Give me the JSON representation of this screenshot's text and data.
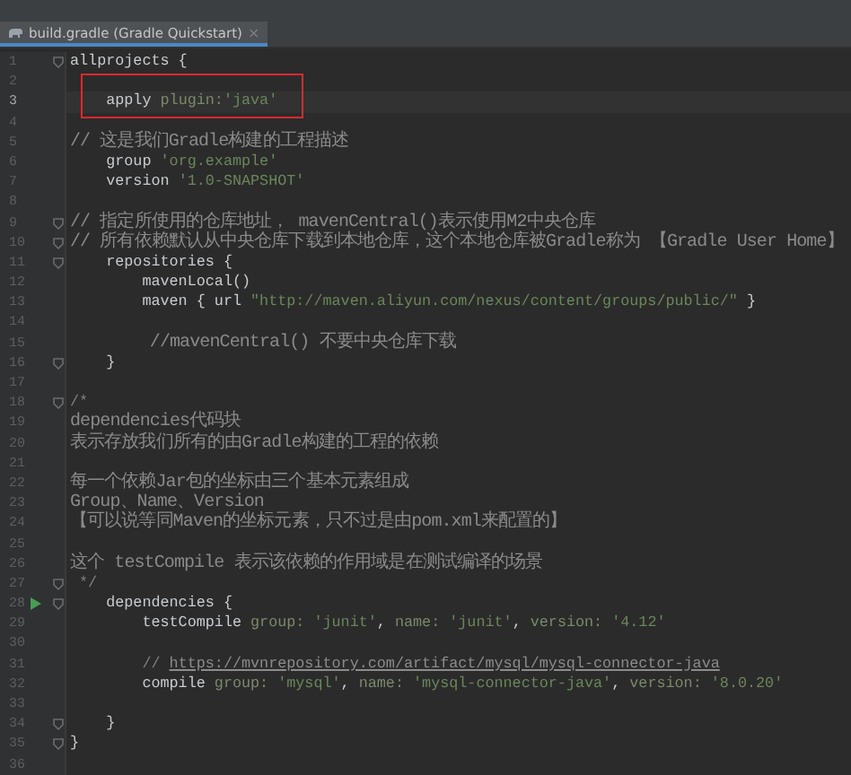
{
  "tab": {
    "title": "build.gradle (Gradle Quickstart)",
    "close": "×",
    "selected": true
  },
  "lines": [
    {
      "n": "1",
      "fold": true,
      "tokens": [
        {
          "kind": "plain",
          "text": "allprojects {"
        }
      ]
    },
    {
      "n": "2",
      "boxed": true
    },
    {
      "n": "3",
      "boxed": true,
      "current": true,
      "tokens": [
        {
          "kind": "plain",
          "text": "    apply "
        },
        {
          "kind": "arg",
          "text": "plugin:"
        },
        {
          "kind": "string",
          "text": "'java'"
        }
      ]
    },
    {
      "n": "4"
    },
    {
      "n": "5",
      "tokens": [
        {
          "kind": "note",
          "text": "// 这是我们Gradle构建的工程描述"
        }
      ]
    },
    {
      "n": "6",
      "tokens": [
        {
          "kind": "plain",
          "text": "    group "
        },
        {
          "kind": "string",
          "text": "'org.example'"
        }
      ]
    },
    {
      "n": "7",
      "tokens": [
        {
          "kind": "plain",
          "text": "    version "
        },
        {
          "kind": "string",
          "text": "'1.0-SNAPSHOT'"
        }
      ]
    },
    {
      "n": "8"
    },
    {
      "n": "9",
      "fold": true,
      "tokens": [
        {
          "kind": "note",
          "text": "// 指定所使用的仓库地址， mavenCentral()表示使用M2中央仓库"
        }
      ]
    },
    {
      "n": "10",
      "fold": true,
      "tokens": [
        {
          "kind": "note",
          "text": "// 所有依赖默认从中央仓库下载到本地仓库，这个本地仓库被Gradle称为 【Gradle User Home】"
        }
      ]
    },
    {
      "n": "11",
      "fold": true,
      "tokens": [
        {
          "kind": "plain",
          "text": "    repositories {"
        }
      ]
    },
    {
      "n": "12",
      "tokens": [
        {
          "kind": "plain",
          "text": "        mavenLocal()"
        }
      ]
    },
    {
      "n": "13",
      "tokens": [
        {
          "kind": "plain",
          "text": "        maven { url "
        },
        {
          "kind": "string",
          "text": "\"http://maven.aliyun.com/nexus/content/groups/public/\""
        },
        {
          "kind": "plain",
          "text": " }"
        }
      ]
    },
    {
      "n": "14"
    },
    {
      "n": "15",
      "tokens": [
        {
          "kind": "note",
          "text": "        //mavenCentral() 不要中央仓库下载"
        }
      ]
    },
    {
      "n": "16",
      "fold": true,
      "tokens": [
        {
          "kind": "plain",
          "text": "    }"
        }
      ]
    },
    {
      "n": "17"
    },
    {
      "n": "18",
      "fold": true,
      "tokens": [
        {
          "kind": "comment",
          "text": "/*"
        }
      ]
    },
    {
      "n": "19",
      "tokens": [
        {
          "kind": "note",
          "text": "dependencies代码块"
        }
      ]
    },
    {
      "n": "20",
      "tokens": [
        {
          "kind": "note",
          "text": "表示存放我们所有的由Gradle构建的工程的依赖"
        }
      ]
    },
    {
      "n": "21"
    },
    {
      "n": "22",
      "tokens": [
        {
          "kind": "note",
          "text": "每一个依赖Jar包的坐标由三个基本元素组成"
        }
      ]
    },
    {
      "n": "23",
      "tokens": [
        {
          "kind": "note",
          "text": "Group、Name、Version"
        }
      ]
    },
    {
      "n": "24",
      "tokens": [
        {
          "kind": "note",
          "text": "【可以说等同Maven的坐标元素，只不过是由pom.xml来配置的】"
        }
      ]
    },
    {
      "n": "25"
    },
    {
      "n": "26",
      "tokens": [
        {
          "kind": "note",
          "text": "这个 testCompile 表示该依赖的作用域是在测试编译的场景"
        }
      ]
    },
    {
      "n": "27",
      "fold": true,
      "tokens": [
        {
          "kind": "comment",
          "text": " */"
        }
      ]
    },
    {
      "n": "28",
      "fold": true,
      "run": true,
      "tokens": [
        {
          "kind": "plain",
          "text": "    dependencies {"
        }
      ]
    },
    {
      "n": "29",
      "tokens": [
        {
          "kind": "plain",
          "text": "        testCompile "
        },
        {
          "kind": "arg",
          "text": "group: "
        },
        {
          "kind": "string",
          "text": "'junit'"
        },
        {
          "kind": "plain",
          "text": ", "
        },
        {
          "kind": "arg",
          "text": "name: "
        },
        {
          "kind": "string",
          "text": "'junit'"
        },
        {
          "kind": "plain",
          "text": ", "
        },
        {
          "kind": "arg",
          "text": "version: "
        },
        {
          "kind": "string",
          "text": "'4.12'"
        }
      ]
    },
    {
      "n": "30"
    },
    {
      "n": "31",
      "tokens": [
        {
          "kind": "comment",
          "text": "        // "
        },
        {
          "kind": "link",
          "text": "https://mvnrepository.com/artifact/mysql/mysql-connector-java"
        }
      ]
    },
    {
      "n": "32",
      "tokens": [
        {
          "kind": "plain",
          "text": "        compile "
        },
        {
          "kind": "arg",
          "text": "group: "
        },
        {
          "kind": "string",
          "text": "'mysql'"
        },
        {
          "kind": "plain",
          "text": ", "
        },
        {
          "kind": "arg",
          "text": "name: "
        },
        {
          "kind": "string",
          "text": "'mysql-connector-java'"
        },
        {
          "kind": "plain",
          "text": ", "
        },
        {
          "kind": "arg",
          "text": "version: "
        },
        {
          "kind": "string",
          "text": "'8.0.20'"
        }
      ]
    },
    {
      "n": "33"
    },
    {
      "n": "34",
      "fold": true,
      "tokens": [
        {
          "kind": "plain",
          "text": "    }"
        }
      ]
    },
    {
      "n": "35",
      "fold": true,
      "tokens": [
        {
          "kind": "plain",
          "text": "}"
        }
      ]
    },
    {
      "n": "36"
    }
  ]
}
